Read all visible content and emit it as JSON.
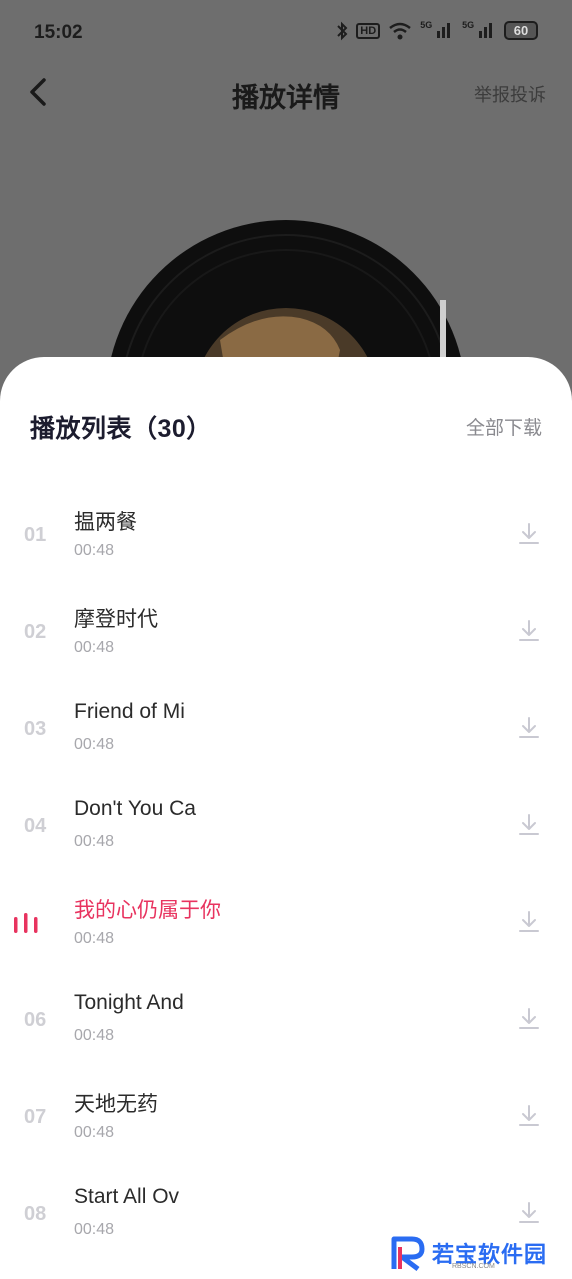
{
  "status": {
    "time": "15:02",
    "battery": "60",
    "hd_label": "HD",
    "network_5g_1": "5G",
    "network_5g_2": "5G"
  },
  "nav": {
    "title": "播放详情",
    "report": "举报投诉"
  },
  "playlist": {
    "title": "播放列表（30）",
    "download_all": "全部下载",
    "tracks": [
      {
        "index": "01",
        "name": "揾两餐",
        "duration": "00:48"
      },
      {
        "index": "02",
        "name": "摩登时代",
        "duration": "00:48"
      },
      {
        "index": "03",
        "name": "Friend of Mi",
        "duration": "00:48"
      },
      {
        "index": "04",
        "name": "Don't You Ca",
        "duration": "00:48"
      },
      {
        "index": "",
        "name": "我的心仍属于你",
        "duration": "00:48"
      },
      {
        "index": "06",
        "name": "Tonight And",
        "duration": "00:48"
      },
      {
        "index": "07",
        "name": "天地无药",
        "duration": "00:48"
      },
      {
        "index": "08",
        "name": "Start All Ov",
        "duration": "00:48"
      }
    ]
  },
  "watermark": {
    "text": "若宝软件园",
    "sub": "RBSCN.COM"
  },
  "colors": {
    "accent": "#e8335f",
    "overlay": "#6e6e6e",
    "sheet": "#ffffff"
  }
}
